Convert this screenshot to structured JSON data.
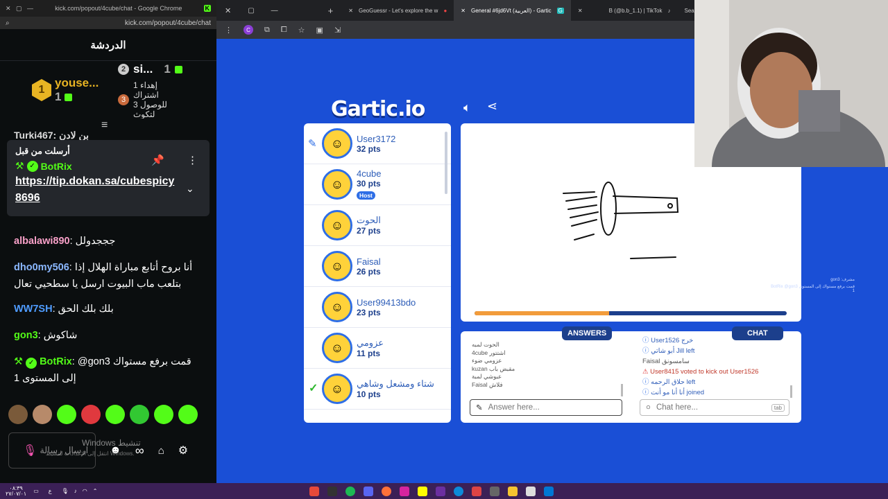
{
  "kick": {
    "title": "kick.com/popout/4cube/chat - Google Chrome",
    "url": "kick.com/popout/4cube/chat",
    "header": "الدردشة",
    "leaderboard": {
      "first_name": "youse...",
      "first_count": "1",
      "first_rank": "1",
      "second_rank": "2",
      "second_name": "si...",
      "second_count": "1",
      "third_rank": "3",
      "third_text": "إهداء 1 اشتراك للوصول 3 لتكوث"
    },
    "partial_top": "Turki467: بن لادن",
    "pinned": {
      "label": "أرسلت من قبل",
      "user": "BotRix",
      "link": "https://tip.dokan.sa/cubespicy8696"
    },
    "messages": [
      {
        "user": "albalawi890",
        "color": "#f8a0c8",
        "text": "جججدولل"
      },
      {
        "user": "dho0my506",
        "color": "#8bb8ff",
        "text": "أنا بروح أتابع مباراة الهلال إذا بتلعب ماب البيوت ارسل يا سطحيي تعال"
      },
      {
        "user": "WW7SH",
        "color": "#4f9cff",
        "text": "بلك بلك الحق"
      },
      {
        "user": "gon3",
        "color": "#53fc18",
        "text": "شاكوش"
      },
      {
        "user": "BotRix",
        "color": "#53fc18",
        "text": "@gon3 قمت برفع مستواك إلى المستوى 1"
      }
    ],
    "input_placeholder": "ارسال رسالة",
    "watermark": "Windows تنشيط",
    "watermark_sub": "انتقل إلى الإعدادات لتنشيط Windows.",
    "emote_colors": [
      "#7a5a3a",
      "#b78a6a",
      "#53fc18",
      "#e0393e",
      "#53fc18",
      "#32c832",
      "#53fc18",
      "#53fc18"
    ]
  },
  "browser": {
    "tabs": [
      {
        "label": "GeoGuessr - Let's explore the w",
        "active": false
      },
      {
        "label": "General #6jd6Vt (العربية) - Gartic",
        "active": true
      },
      {
        "label": "B (@b.b_1.1) | TikTok",
        "active": false
      },
      {
        "label": "Sear",
        "active": false
      }
    ]
  },
  "gartic": {
    "logo": "Gartic.io",
    "players": [
      {
        "name": "User3172",
        "pts": "32 pts",
        "drawing": true,
        "host": false
      },
      {
        "name": "4cube",
        "pts": "30 pts",
        "drawing": false,
        "host": true
      },
      {
        "name": "الحوت",
        "pts": "27 pts",
        "drawing": false,
        "host": false
      },
      {
        "name": "Faisal",
        "pts": "26 pts",
        "drawing": false,
        "host": false
      },
      {
        "name": "User99413bdo",
        "pts": "23 pts",
        "drawing": false,
        "host": false
      },
      {
        "name": "عزومي",
        "pts": "11 pts",
        "drawing": false,
        "host": false
      },
      {
        "name": "شتاء ومشعل وشاهي",
        "pts": "10 pts",
        "drawing": false,
        "host": false,
        "guessed": true
      }
    ],
    "host_label": "Host",
    "progress": 0.43,
    "answers_tab": "ANSWERS",
    "chat_tab": "CHAT",
    "answers": [
      "الحوت لمبه",
      "4cube اشتتور",
      "عزومي ضوء",
      "kuzan مقبض باب",
      "عبوشي لمبة",
      "Faisal فلاش"
    ],
    "chat_lines": [
      {
        "text": "User1526 خرج",
        "kind": "info"
      },
      {
        "text": "أبو شاتي Jill left",
        "kind": "info"
      },
      {
        "text": "Faisal سامسونق",
        "kind": "plain"
      },
      {
        "text": "User8415 voted to kick out User1526",
        "kind": "warn"
      },
      {
        "text": "حلاق الرحمه left",
        "kind": "info"
      },
      {
        "text": "أنا أنا مو أنت joined",
        "kind": "info"
      }
    ],
    "answer_placeholder": "Answer here...",
    "chat_placeholder": "Chat here...",
    "chat_key": "tab",
    "overlay_line1": "gon3 :مشرف",
    "overlay_line2": "BotRix @gon3 قمت برفع مستواك إلى المستوى 1"
  },
  "taskbar": {
    "time": "٠٨:٣٩",
    "date": "٢٧/٠٧/٠١",
    "lang": "ع"
  }
}
